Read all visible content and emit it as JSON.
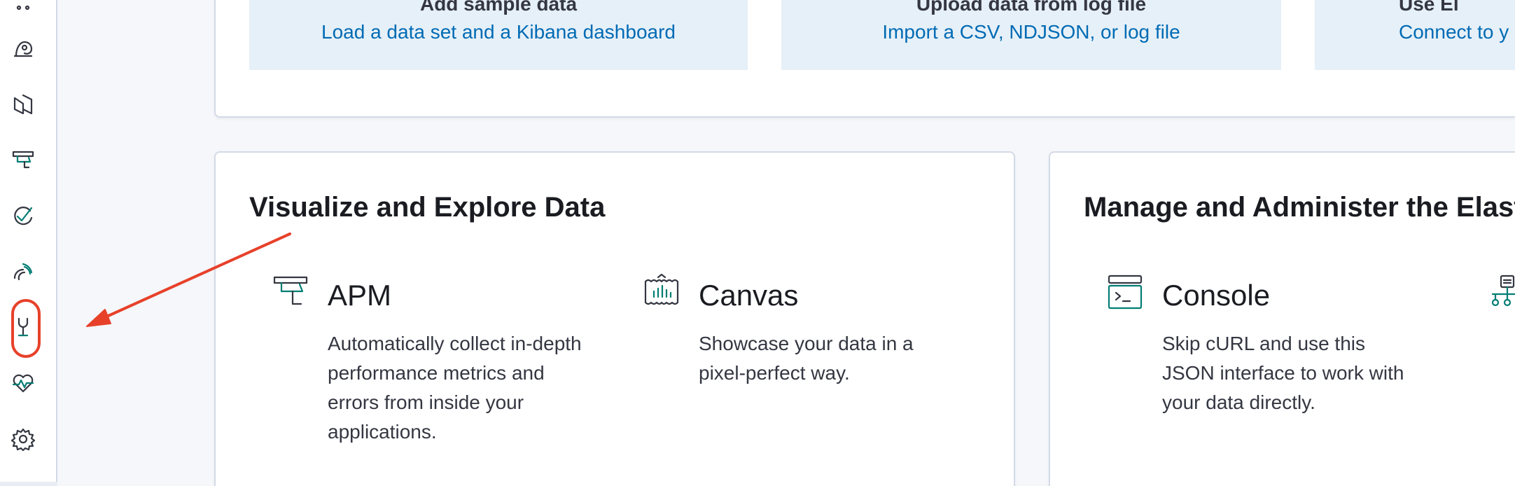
{
  "sidebar": {
    "items": [
      {
        "icon": "dots-icon"
      },
      {
        "icon": "maps-icon"
      },
      {
        "icon": "visualize-icon"
      },
      {
        "icon": "apm-icon"
      },
      {
        "icon": "uptime-icon"
      },
      {
        "icon": "siem-icon"
      },
      {
        "icon": "dev-tools-icon"
      },
      {
        "icon": "monitoring-icon"
      },
      {
        "icon": "management-gear-icon"
      }
    ],
    "highlighted_item": "dev-tools-icon",
    "highlight_color": "#e7412a"
  },
  "add_data": {
    "tiles": [
      {
        "title": "Add sample data",
        "description": "Load a data set and a Kibana dashboard"
      },
      {
        "title": "Upload data from log file",
        "description": "Import a CSV, NDJSON, or log file"
      },
      {
        "title": "Use El",
        "description": "Connect to y"
      }
    ]
  },
  "visualize": {
    "title": "Visualize and Explore Data",
    "features": [
      {
        "icon": "apm-feature-icon",
        "title": "APM",
        "description": "Automatically collect in-depth performance metrics and errors from inside your applications."
      },
      {
        "icon": "canvas-icon",
        "title": "Canvas",
        "description": "Showcase your data in a pixel-perfect way."
      }
    ]
  },
  "manage": {
    "title": "Manage and Administer the Elastic",
    "features": [
      {
        "icon": "console-icon",
        "title": "Console",
        "description": "Skip cURL and use this JSON interface to work with your data directly."
      },
      {
        "icon": "index-patterns-icon",
        "title": "",
        "description": ""
      }
    ]
  },
  "colors": {
    "link": "#006bb4",
    "tile_bg": "#e6f0f8",
    "annotation_red": "#e7412a",
    "icon_teal": "#017d73"
  }
}
